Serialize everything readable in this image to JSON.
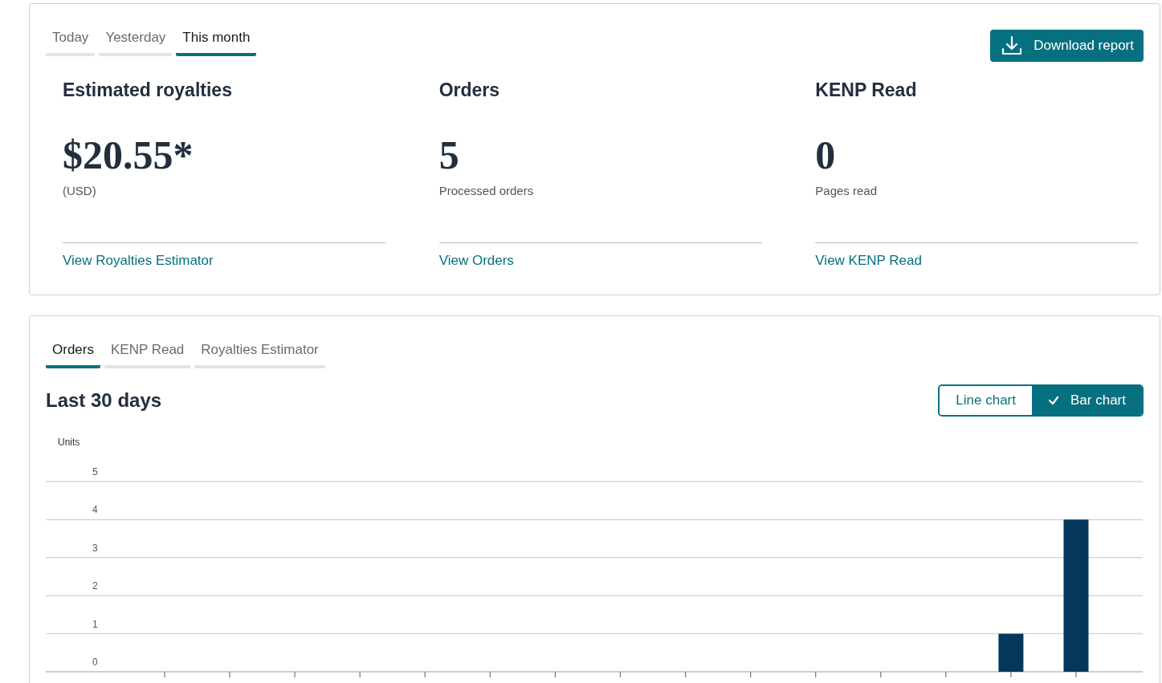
{
  "summary_card": {
    "tabs": [
      {
        "label": "Today",
        "selected": false
      },
      {
        "label": "Yesterday",
        "selected": false
      },
      {
        "label": "This month",
        "selected": true
      }
    ],
    "download_button": "Download report",
    "metrics": [
      {
        "title": "Estimated royalties",
        "value": "$20.55*",
        "caption": "(USD)",
        "link": "View Royalties Estimator"
      },
      {
        "title": "Orders",
        "value": "5",
        "caption": "Processed orders",
        "link": "View Orders"
      },
      {
        "title": "KENP Read",
        "value": "0",
        "caption": "Pages read",
        "link": "View KENP Read"
      }
    ]
  },
  "chart_card": {
    "tabs": [
      {
        "label": "Orders",
        "selected": true
      },
      {
        "label": "KENP Read",
        "selected": false
      },
      {
        "label": "Royalties Estimator",
        "selected": false
      }
    ],
    "title": "Last 30 days",
    "chart_types": [
      {
        "label": "Line chart",
        "selected": false
      },
      {
        "label": "Bar chart",
        "selected": true
      }
    ],
    "chart_data": {
      "type": "bar",
      "grid": true,
      "ylabel": "Units",
      "ylim": [
        0,
        5
      ],
      "yticks": [
        0,
        1,
        2,
        3,
        4,
        5
      ],
      "values": [
        0,
        0,
        0,
        0,
        0,
        0,
        0,
        0,
        0,
        0,
        0,
        0,
        0,
        1,
        4
      ]
    }
  }
}
